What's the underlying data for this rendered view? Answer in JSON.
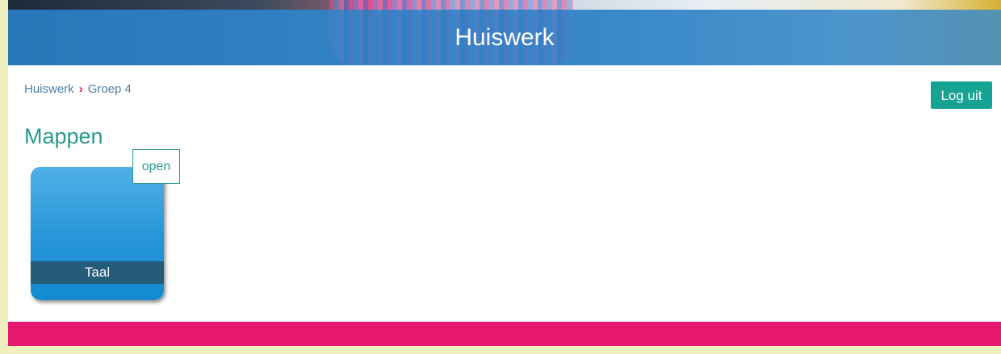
{
  "header": {
    "title": "Huiswerk"
  },
  "breadcrumb": {
    "items": [
      "Huiswerk",
      "Groep 4"
    ],
    "separator": "›"
  },
  "account": {
    "logout_label": "Log uit"
  },
  "main": {
    "section_title": "Mappen",
    "folders": [
      {
        "label": "Taal",
        "badge": "open"
      }
    ]
  },
  "colors": {
    "accent": "#17a394",
    "heading": "#2a9a8f",
    "banner_overlay": "#2882c8",
    "folder": "#2694d8",
    "folder_label_bar": "#245c7a",
    "footer": "#e5176f",
    "breadcrumb_separator": "#e0185c",
    "page_border": "#efefc0"
  }
}
